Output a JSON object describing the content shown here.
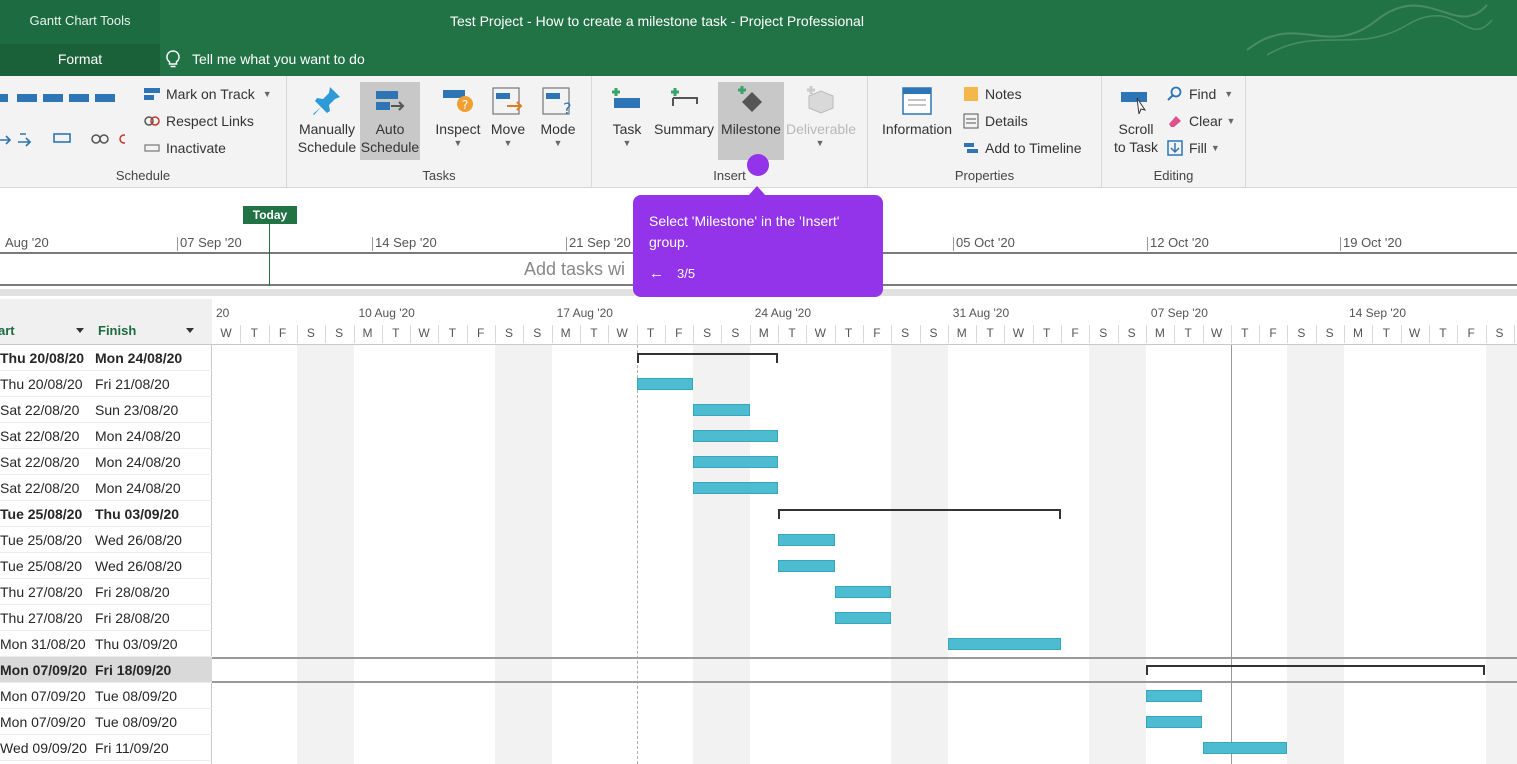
{
  "titlebar": {
    "context_group": "Gantt Chart Tools",
    "format_tab": "Format",
    "window_title": "Test Project - How to create a milestone task  -  Project Professional",
    "tell_me": "Tell me what you want to do"
  },
  "ribbon": {
    "schedule": {
      "label": "Schedule",
      "pct": [
        "0%",
        "25%",
        "50%",
        "75%",
        "100%"
      ],
      "mark_on_track": "Mark on Track",
      "respect_links": "Respect Links",
      "inactivate": "Inactivate"
    },
    "tasks": {
      "label": "Tasks",
      "manually": [
        "Manually",
        "Schedule"
      ],
      "auto": [
        "Auto",
        "Schedule"
      ],
      "inspect": "Inspect",
      "move": "Move",
      "mode": "Mode"
    },
    "insert": {
      "label": "Insert",
      "task": "Task",
      "summary": "Summary",
      "milestone": "Milestone",
      "deliverable": "Deliverable"
    },
    "properties": {
      "label": "Properties",
      "information": "Information",
      "notes": "Notes",
      "details": "Details",
      "add_to_timeline": "Add to Timeline"
    },
    "editing": {
      "label": "Editing",
      "scroll": [
        "Scroll",
        "to Task"
      ],
      "find": "Find",
      "clear": "Clear",
      "fill": "Fill"
    }
  },
  "timeline": {
    "today": "Today",
    "dates": [
      "Aug '20",
      "07 Sep '20",
      "14 Sep '20",
      "21 Sep '20",
      "05 Oct '20",
      "12 Oct '20",
      "19 Oct '20"
    ],
    "placeholder": "Add tasks wi"
  },
  "table": {
    "col_start": "Start",
    "col_finish": "Finish",
    "rows": [
      {
        "start": "Thu 20/08/20",
        "finish": "Mon 24/08/20",
        "bold": true
      },
      {
        "start": "Thu 20/08/20",
        "finish": "Fri 21/08/20"
      },
      {
        "start": "Sat 22/08/20",
        "finish": "Sun 23/08/20"
      },
      {
        "start": "Sat 22/08/20",
        "finish": "Mon 24/08/20"
      },
      {
        "start": "Sat 22/08/20",
        "finish": "Mon 24/08/20"
      },
      {
        "start": "Sat 22/08/20",
        "finish": "Mon 24/08/20"
      },
      {
        "start": "Tue 25/08/20",
        "finish": "Thu 03/09/20",
        "bold": true
      },
      {
        "start": "Tue 25/08/20",
        "finish": "Wed 26/08/20"
      },
      {
        "start": "Tue 25/08/20",
        "finish": "Wed 26/08/20"
      },
      {
        "start": "Thu 27/08/20",
        "finish": "Fri 28/08/20"
      },
      {
        "start": "Thu 27/08/20",
        "finish": "Fri 28/08/20"
      },
      {
        "start": "Mon 31/08/20",
        "finish": "Thu 03/09/20"
      },
      {
        "start": "Mon 07/09/20",
        "finish": "Fri 18/09/20",
        "bold": true,
        "selected": true
      },
      {
        "start": "Mon 07/09/20",
        "finish": "Tue 08/09/20"
      },
      {
        "start": "Mon 07/09/20",
        "finish": "Tue 08/09/20"
      },
      {
        "start": "Wed 09/09/20",
        "finish": "Fri 11/09/20"
      }
    ]
  },
  "gantt": {
    "weeks": [
      "20",
      "10 Aug '20",
      "17 Aug '20",
      "24 Aug '20",
      "31 Aug '20",
      "07 Sep '20",
      "14 Sep '20"
    ],
    "first_week_days": [
      "W",
      "T",
      "F",
      "S",
      "S"
    ],
    "week_days": [
      "M",
      "T",
      "W",
      "T",
      "F",
      "S",
      "S"
    ],
    "first_visible_date": "2020-08-05"
  },
  "tooltip": {
    "message": "Select 'Milestone' in the 'Insert' group.",
    "back": "←",
    "step": "3/5"
  },
  "colors": {
    "brand_green": "#217346",
    "bar": "#4dbbd0",
    "tooltip": "#9333ea"
  }
}
